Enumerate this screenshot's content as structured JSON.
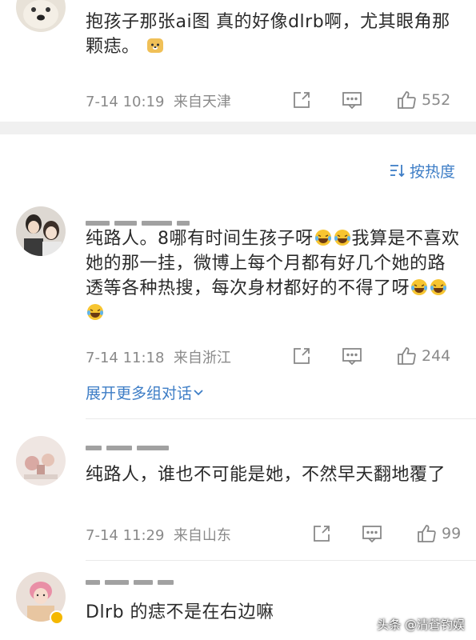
{
  "comments": [
    {
      "text": "抱孩子那张ai图 真的好像dlrb啊，尤其眼角那颗痣。",
      "time": "7-14 10:19",
      "location": "来自天津",
      "likes": "552"
    },
    {
      "text": "纯路人。8哪有时间生孩子呀",
      "text_mid": "我算是不喜欢她的那一挂，微博上每个月都有好几个她的路透等各种热搜，每次身材都好的不得了呀",
      "time": "7-14 11:18",
      "location": "来自浙江",
      "likes": "244",
      "expand_label": "展开更多组对话"
    },
    {
      "text": "纯路人，谁也不可能是她，不然早天翻地覆了",
      "time": "7-14 11:29",
      "location": "来自山东",
      "likes": "99"
    },
    {
      "text": "Dlrb 的痣不是在右边嘛"
    }
  ],
  "sort_label": "按热度",
  "watermark": "头条 @清蒼钓娱",
  "icons": {
    "share": "share-icon",
    "comment": "comment-icon",
    "like": "thumbs-up-icon",
    "sort": "sort-icon",
    "emoji_laugh": "laughing-emoji",
    "emoji_doge": "doge-emoji"
  },
  "colors": {
    "link": "#3d7dc6",
    "meta": "#8a8a8a",
    "band": "#f0f0f0"
  }
}
